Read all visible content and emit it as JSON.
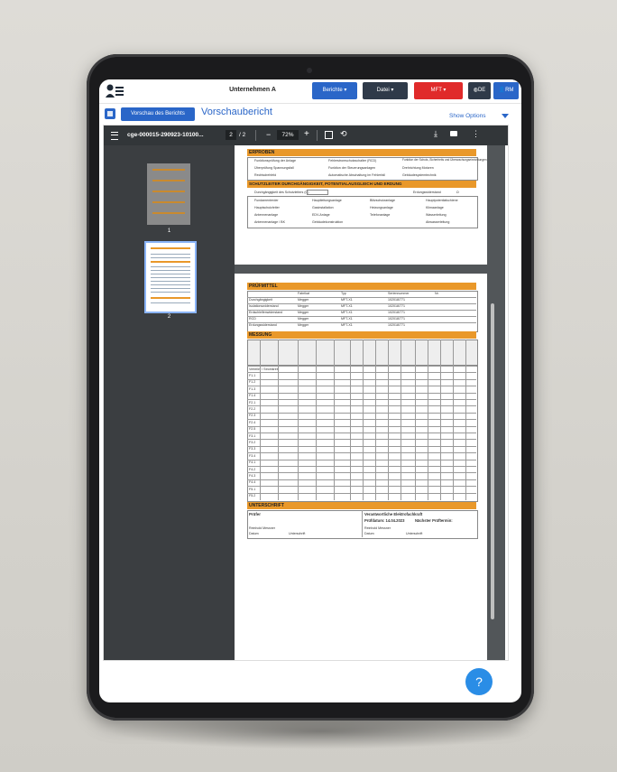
{
  "app": {
    "company": "Unternehmen A",
    "menu": {
      "berichte": "Berichte ▾",
      "datei": "Datei ▾",
      "mft": "MFT ▾",
      "lang": "DE",
      "user": "RM"
    }
  },
  "subbar": {
    "preview_button": "Vorschau des Berichts",
    "title": "Vorschaubericht",
    "show_options": "Show Options"
  },
  "pdf": {
    "filename": "cge-000015-290923-10100...",
    "page_current": "2",
    "page_total": "/ 2",
    "zoom": "72%",
    "thumbnail_labels": [
      "1",
      "2"
    ]
  },
  "page1": {
    "sections": [
      "ERPROBEN",
      "SCHUTZLEITER DURCHGÄNGIGKEIT, POTENTIALAUSGLEICH UND ERDUNG"
    ],
    "erproben_items": [
      [
        "Funktionsprüfung der Anlage",
        "Fehlerstromschutzschalter (RCD)",
        "Funktion der Schutz-,Sicherheits und Überwachungseinrichtungen"
      ],
      [
        "Überprüfung Spannungsfall",
        "Funktion der Steuerungsanlagen",
        "Drehrichtung Motoren"
      ],
      [
        "Rechtsdrehfeld",
        "Automatische Abschaltung im Fehlerfall",
        "Gebäudesystemtechnik"
      ]
    ],
    "schutzleiter_label": "Durchgängigkeit des Schutzleiters (Ω)",
    "erdung_label": "Erdungswiderstand",
    "erdung_unit": "Ω",
    "potential_items": [
      [
        "Fundamenterder",
        "Hauptleitungsanlage",
        "Blitzschutzanlage",
        "Hauptpotentialschiene"
      ],
      [
        "Hauptschutzleiter",
        "Gasinstallation",
        "Heizungsanlage",
        "Klimaanlage"
      ],
      [
        "Antennenanlage",
        "EDV-Anlage",
        "Telefonanlage",
        "Wasserleitung"
      ],
      [
        "Antennenanlage / BK",
        "Gebäudekonstruktion",
        "",
        "Abwasserleitung"
      ]
    ]
  },
  "page2": {
    "sections": [
      "PRÜFMITTEL",
      "MESSUNG",
      "UNTERSCHRIFT"
    ],
    "pruefmittel_headers": [
      "Fabrikat",
      "Typ",
      "Seriennummer",
      "Nr."
    ],
    "pruefmittel_rows": [
      [
        "Durchgängigkeit",
        "Megger",
        "MFT-X1",
        "102018/771"
      ],
      [
        "Isolationswiderstand",
        "Megger",
        "MFT-X1",
        "102018/771"
      ],
      [
        "Erdschleifenwiderstand",
        "Megger",
        "MFT-X1",
        "102018/771"
      ],
      [
        "RCD",
        "Megger",
        "MFT-X1",
        "102018/771"
      ],
      [
        "Erdungswiderstand",
        "Megger",
        "MFT-X1",
        "102018/771"
      ]
    ],
    "messung_rows": [
      "Verteiler / Stromkreis",
      "F1.1",
      "F1.2",
      "F1.3",
      "F1.4",
      "F2.1",
      "F2.2",
      "F2.3",
      "F2.4",
      "F2.5",
      "F3.1",
      "F3.2",
      "F3.3",
      "F3.4",
      "F4.1",
      "F4.2",
      "F4.3",
      "F4.4",
      "F5.1",
      "F5.2"
    ],
    "pruefer_label": "Prüfer",
    "pruefer_name": "Reinhold Messner",
    "datum_label": "Datum",
    "unterschrift_label": "Unterschrift",
    "elektro_label": "Verantwortliche Elektrofachkraft",
    "pruefdatum": "Prüfdatum: 14.04.2023",
    "naechster": "Nächster Prüftermin:",
    "elektro_name": "Reinhold Messner"
  },
  "help": "?"
}
